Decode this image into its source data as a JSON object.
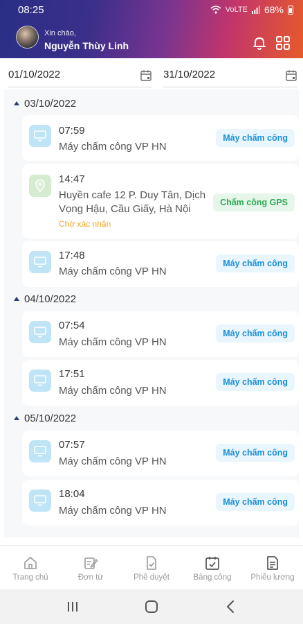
{
  "status_bar": {
    "time": "08:25",
    "signal_text": "VoLTE",
    "battery_pct": "68%"
  },
  "header": {
    "greeting": "Xin chào,",
    "user_name": "Nguyễn Thùy Linh"
  },
  "date_range": {
    "from": "01/10/2022",
    "to": "31/10/2022"
  },
  "days": [
    {
      "date": "03/10/2022",
      "entries": [
        {
          "time": "07:59",
          "place": "Máy chấm công VP HN",
          "status": "",
          "tag": "Máy chấm công",
          "kind": "machine"
        },
        {
          "time": "14:47",
          "place": "Huyền cafe 12 P. Duy Tân, Dịch Vọng Hậu, Cầu Giấy, Hà Nội",
          "status": "Chờ xác nhận",
          "tag": "Chấm công GPS",
          "kind": "gps"
        },
        {
          "time": "17:48",
          "place": "Máy chấm công VP HN",
          "status": "",
          "tag": "Máy chấm công",
          "kind": "machine"
        }
      ]
    },
    {
      "date": "04/10/2022",
      "entries": [
        {
          "time": "07:54",
          "place": "Máy chấm công VP HN",
          "status": "",
          "tag": "Máy chấm công",
          "kind": "machine"
        },
        {
          "time": "17:51",
          "place": "Máy chấm công VP HN",
          "status": "",
          "tag": "Máy chấm công",
          "kind": "machine"
        }
      ]
    },
    {
      "date": "05/10/2022",
      "entries": [
        {
          "time": "07:57",
          "place": "Máy chấm công VP HN",
          "status": "",
          "tag": "Máy chấm công",
          "kind": "machine"
        },
        {
          "time": "18:04",
          "place": "Máy chấm công VP HN",
          "status": "",
          "tag": "Máy chấm công",
          "kind": "machine"
        }
      ]
    }
  ],
  "bottom_nav": [
    {
      "label": "Trang chủ",
      "icon": "home-icon"
    },
    {
      "label": "Đơn từ",
      "icon": "edit-form-icon"
    },
    {
      "label": "Phê duyệt",
      "icon": "approve-doc-icon"
    },
    {
      "label": "Bảng công",
      "icon": "calendar-check-icon"
    },
    {
      "label": "Phiếu lương",
      "icon": "payslip-icon"
    }
  ],
  "colors": {
    "accent_blue": "#1a8fd8",
    "gps_green": "#2eaa58",
    "pending_orange": "#f5a623",
    "day_marker": "#2c3e75"
  }
}
